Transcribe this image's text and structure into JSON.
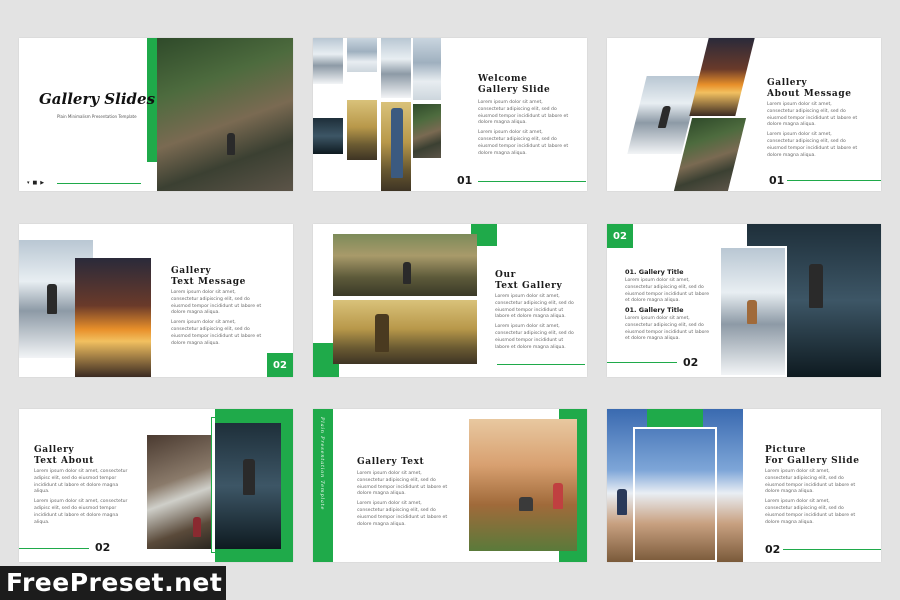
{
  "slides": {
    "s1": {
      "title": "Gallery Slides",
      "subtitle": "Plain Minimalism Presentation Template",
      "social": [
        "twitter-icon",
        "facebook-icon",
        "youtube-icon"
      ]
    },
    "s2": {
      "title": "Welcome\nGallery Slide",
      "p1": "Lorem ipsum dolor sit amet, consectetur adipiscing elit, sed do eiusmod tempor incididunt ut labore et dolore magna aliqua.",
      "p2": "Lorem ipsum dolor sit amet, consectetur adipiscing elit, sed do eiusmod tempor incididunt ut labore et dolore magna aliqua.",
      "number": "01"
    },
    "s3": {
      "title": "Gallery\nAbout Message",
      "p1": "Lorem ipsum dolor sit amet, consectetur adipiscing elit, sed do eiusmod tempor incididunt ut labore et dolore magna aliqua.",
      "p2": "Lorem ipsum dolor sit amet, consectetur adipiscing elit, sed do eiusmod tempor incididunt ut labore et dolore magna aliqua.",
      "number": "01"
    },
    "s4": {
      "title": "Gallery\nText Message",
      "p1": "Lorem ipsum dolor sit amet, consectetur adipiscing elit, sed do eiusmod tempor incididunt ut labore et dolore magna aliqua.",
      "p2": "Lorem ipsum dolor sit amet, consectetur adipiscing elit, sed do eiusmod tempor incididunt ut labore et dolore magna aliqua.",
      "number": "02"
    },
    "s5": {
      "title": "Our\nText Gallery",
      "p1": "Lorem ipsum dolor sit amet, consectetur adipiscing elit, sed do eiusmod tempor incididunt ut labore et dolore magna aliqua.",
      "p2": "Lorem ipsum dolor sit amet, consectetur adipiscing elit, sed do eiusmod tempor incididunt ut labore et dolore magna aliqua."
    },
    "s6": {
      "number_top": "02",
      "h1": "01. Gallery Title",
      "p1": "Lorem ipsum dolor sit amet, consectetur adipiscing elit, sed do eiusmod tempor incididunt ut labore et dolore magna aliqua.",
      "h2": "01. Gallery Title",
      "p2": "Lorem ipsum dolor sit amet, consectetur adipiscing elit, sed do eiusmod tempor incididunt ut labore et dolore magna aliqua.",
      "number": "02"
    },
    "s7": {
      "title": "Gallery\nText About",
      "p1": "Lorem ipsum dolor sit amet, consectetur adipisc elit, sed do eiusmod tempor incididunt ut labore et dolore magna aliqua.",
      "p2": "Lorem ipsum dolor sit amet, consectetur adipisc elit, sed do eiusmod tempor incididunt ut labore et dolore magna aliqua.",
      "number": "02"
    },
    "s8": {
      "title": "Gallery Text",
      "vertical": "Plain Presentation Template",
      "p1": "Lorem ipsum dolor sit amet, consectetur adipiscing elit, sed do eiusmod tempor incididunt ut labore et dolore magna aliqua.",
      "p2": "Lorem ipsum dolor sit amet, consectetur adipiscing elit, sed do eiusmod tempor incididunt ut labore et dolore magna aliqua."
    },
    "s9": {
      "title": "Picture\nFor Gallery Slide",
      "p1": "Lorem ipsum dolor sit amet, consectetur adipiscing elit, sed do eiusmod tempor incididunt ut labore et dolore magna aliqua.",
      "p2": "Lorem ipsum dolor sit amet, consectetur adipiscing elit, sed do eiusmod tempor incididunt ut labore et dolore magna aliqua.",
      "number": "02"
    }
  },
  "watermark": "FreePreset.net",
  "colors": {
    "accent": "#1faa4a",
    "background": "#e3e3e3",
    "slide": "#ffffff"
  }
}
